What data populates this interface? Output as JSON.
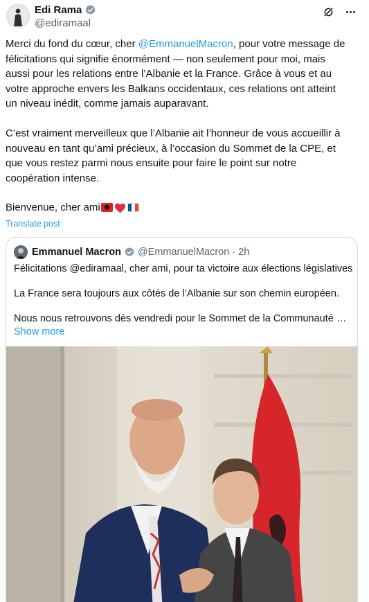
{
  "author": {
    "name": "Edi Rama",
    "handle": "@ediramaal"
  },
  "header_icons": [
    "grok-icon",
    "more-icon"
  ],
  "tweet": {
    "p1_a": "Merci du fond du cœur, cher ",
    "p1_mention": "@EmmanuelMacron",
    "p1_b": ", pour votre message de",
    "p1_lines": [
      "félicitations qui signifie énormément — non seulement pour moi, mais",
      "aussi pour les relations entre l’Albanie et la France. Grâce à vous et au",
      "votre approche envers les Balkans occidentaux, ces relations ont atteint",
      "un niveau inédit, comme jamais auparavant."
    ],
    "p2_lines": [
      "C’est vraiment merveilleux que l’Albanie ait l’honneur de vous accueillir à",
      "nouveau en tant qu’ami précieux, à l’occasion du Sommet de la CPE, et",
      "que vous restez parmi nous ensuite pour faire le point sur notre",
      "coopération intense."
    ],
    "p3": "Bienvenue, cher ami",
    "emoji": [
      "albania-flag",
      "red-heart",
      "france-flag"
    ]
  },
  "translate_label": "Translate post",
  "quote": {
    "name": "Emmanuel Macron",
    "handle": "@EmmanuelMacron",
    "separator": "·",
    "time": "2h",
    "line1": "Félicitations @ediramaal, cher ami, pour ta victoire aux élections législatives.",
    "line2": "La France sera toujours aux côtés de l’Albanie sur son chemin européen.",
    "line3": "Nous nous retrouvons dès vendredi pour le Sommet de la Communauté …",
    "show_more": "Show more"
  },
  "colors": {
    "link": "#1d9bf0",
    "text": "#0f1419",
    "secondary": "#536471",
    "border": "#cfd9de"
  }
}
